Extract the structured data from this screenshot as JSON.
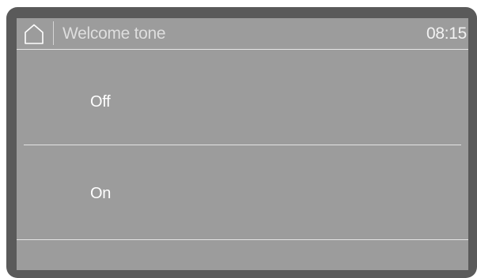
{
  "header": {
    "home_icon": "home-icon",
    "title": "Welcome tone",
    "time": "08:15"
  },
  "options": [
    {
      "label": "Off"
    },
    {
      "label": "On"
    }
  ],
  "colors": {
    "bezel": "#5a5a5a",
    "screen": "#9c9c9c",
    "text": "#ffffff",
    "divider": "#e4e4e4"
  }
}
